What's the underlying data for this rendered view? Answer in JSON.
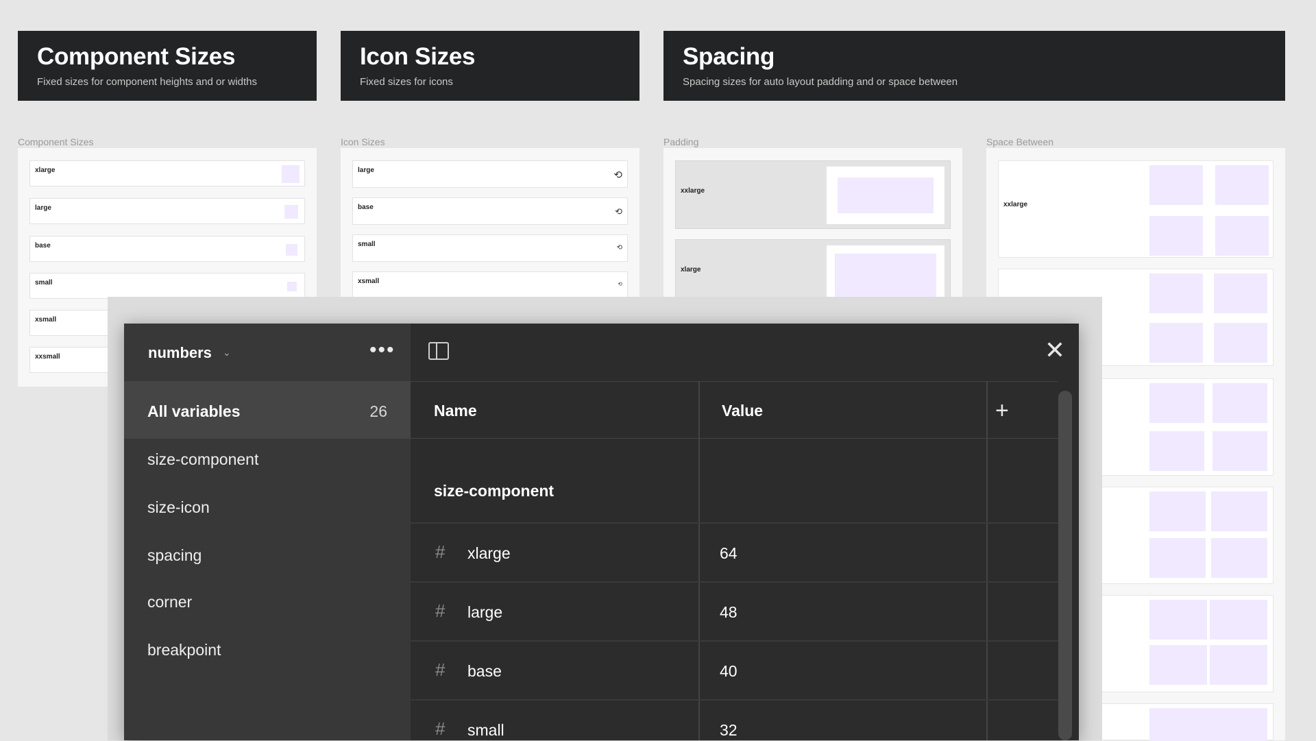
{
  "canvas": {
    "headers": [
      {
        "title": "Component Sizes",
        "subtitle": "Fixed sizes for component heights and or widths"
      },
      {
        "title": "Icon Sizes",
        "subtitle": "Fixed sizes for icons"
      },
      {
        "title": "Spacing",
        "subtitle": "Spacing sizes for auto layout padding and or space between"
      }
    ],
    "section_labels": [
      "Component Sizes",
      "Icon Sizes",
      "Padding",
      "Space Between"
    ],
    "component_rows": [
      "xlarge",
      "large",
      "base",
      "small",
      "xsmall",
      "xxsmall"
    ],
    "icon_rows": [
      "large",
      "base",
      "small",
      "xsmall"
    ],
    "padding_rows": [
      "xxlarge",
      "xlarge"
    ],
    "space_rows": [
      "xxlarge"
    ]
  },
  "modal": {
    "collection": "numbers",
    "all_variables": {
      "label": "All variables",
      "count": "26"
    },
    "groups": [
      "size-component",
      "size-icon",
      "spacing",
      "corner",
      "breakpoint"
    ],
    "columns": {
      "name": "Name",
      "value": "Value"
    },
    "current_group": "size-component",
    "rows": [
      {
        "name": "xlarge",
        "value": "64"
      },
      {
        "name": "large",
        "value": "48"
      },
      {
        "name": "base",
        "value": "40"
      },
      {
        "name": "small",
        "value": "32"
      }
    ]
  }
}
